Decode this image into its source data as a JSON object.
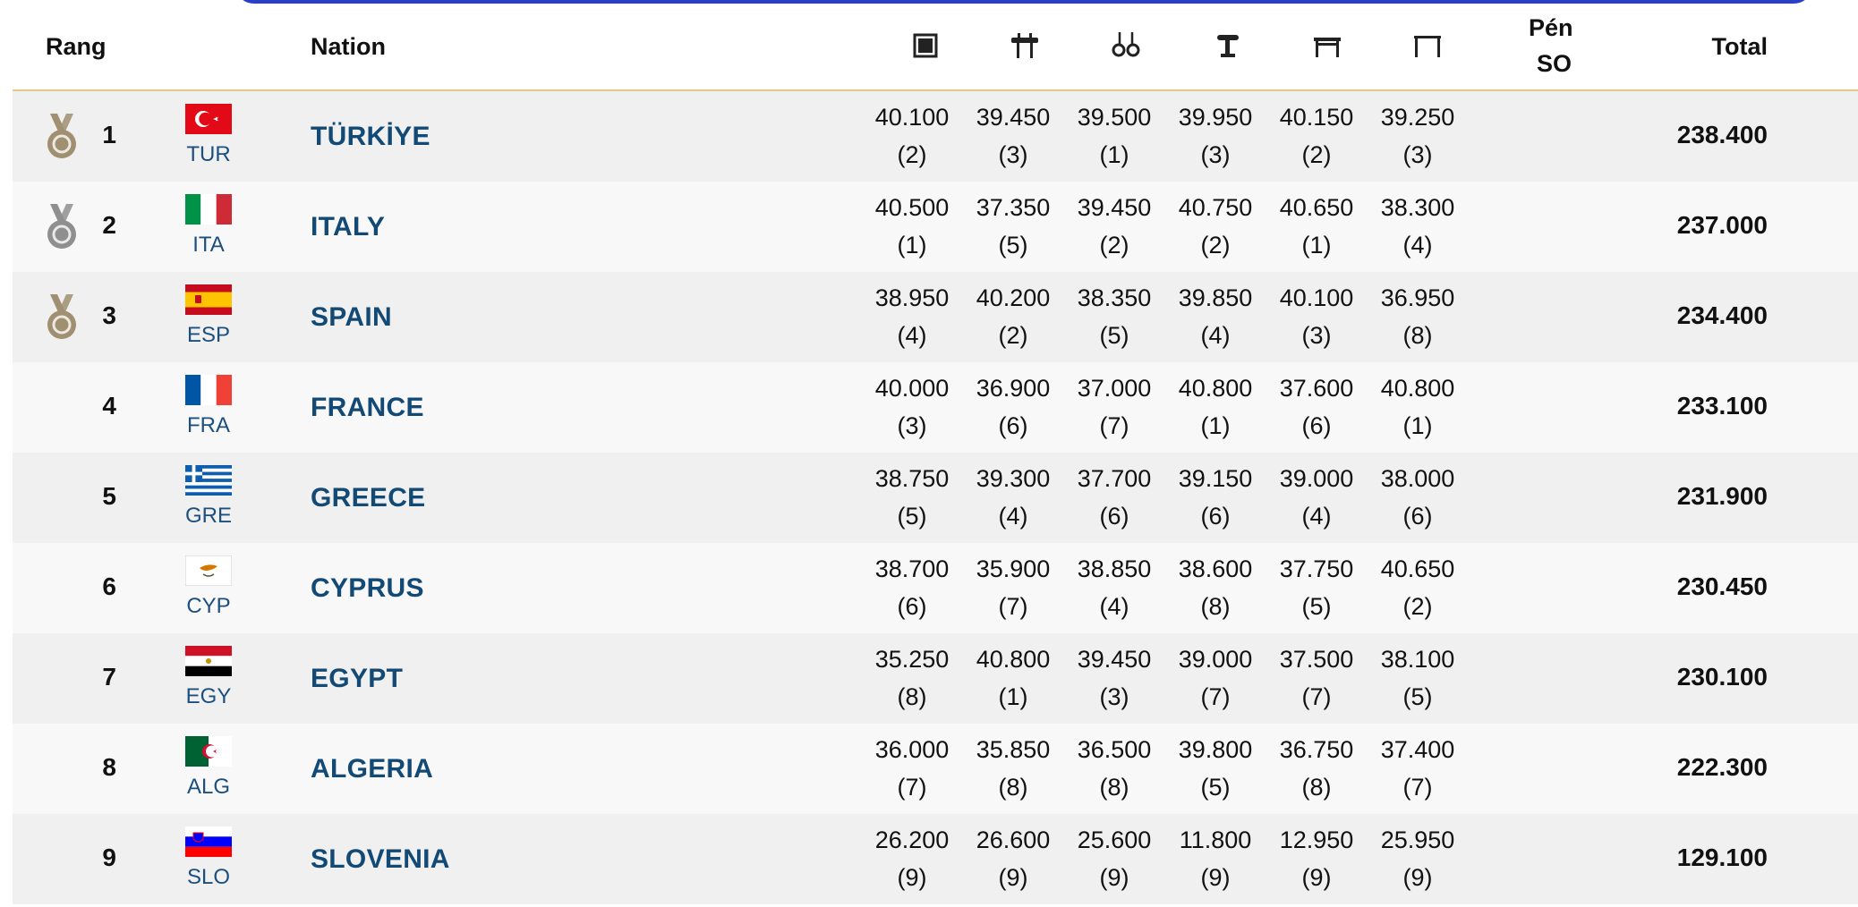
{
  "header": {
    "rank": "Rang",
    "nation": "Nation",
    "apparatus_icons": [
      "floor-exercise-icon",
      "pommel-horse-icon",
      "rings-icon",
      "vault-icon",
      "parallel-bars-icon",
      "horizontal-bar-icon"
    ],
    "penalty_line1": "Pén",
    "penalty_line2": "SO",
    "total": "Total"
  },
  "rows": [
    {
      "rank": "1",
      "medal": "gold",
      "code": "TUR",
      "nation": "TÜRKİYE",
      "scores": [
        [
          "40.100",
          "(2)"
        ],
        [
          "39.450",
          "(3)"
        ],
        [
          "39.500",
          "(1)"
        ],
        [
          "39.950",
          "(3)"
        ],
        [
          "40.150",
          "(2)"
        ],
        [
          "39.250",
          "(3)"
        ]
      ],
      "total": "238.400"
    },
    {
      "rank": "2",
      "medal": "silver",
      "code": "ITA",
      "nation": "ITALY",
      "scores": [
        [
          "40.500",
          "(1)"
        ],
        [
          "37.350",
          "(5)"
        ],
        [
          "39.450",
          "(2)"
        ],
        [
          "40.750",
          "(2)"
        ],
        [
          "40.650",
          "(1)"
        ],
        [
          "38.300",
          "(4)"
        ]
      ],
      "total": "237.000"
    },
    {
      "rank": "3",
      "medal": "bronze",
      "code": "ESP",
      "nation": "SPAIN",
      "scores": [
        [
          "38.950",
          "(4)"
        ],
        [
          "40.200",
          "(2)"
        ],
        [
          "38.350",
          "(5)"
        ],
        [
          "39.850",
          "(4)"
        ],
        [
          "40.100",
          "(3)"
        ],
        [
          "36.950",
          "(8)"
        ]
      ],
      "total": "234.400"
    },
    {
      "rank": "4",
      "medal": "",
      "code": "FRA",
      "nation": "FRANCE",
      "scores": [
        [
          "40.000",
          "(3)"
        ],
        [
          "36.900",
          "(6)"
        ],
        [
          "37.000",
          "(7)"
        ],
        [
          "40.800",
          "(1)"
        ],
        [
          "37.600",
          "(6)"
        ],
        [
          "40.800",
          "(1)"
        ]
      ],
      "total": "233.100"
    },
    {
      "rank": "5",
      "medal": "",
      "code": "GRE",
      "nation": "GREECE",
      "scores": [
        [
          "38.750",
          "(5)"
        ],
        [
          "39.300",
          "(4)"
        ],
        [
          "37.700",
          "(6)"
        ],
        [
          "39.150",
          "(6)"
        ],
        [
          "39.000",
          "(4)"
        ],
        [
          "38.000",
          "(6)"
        ]
      ],
      "total": "231.900"
    },
    {
      "rank": "6",
      "medal": "",
      "code": "CYP",
      "nation": "CYPRUS",
      "scores": [
        [
          "38.700",
          "(6)"
        ],
        [
          "35.900",
          "(7)"
        ],
        [
          "38.850",
          "(4)"
        ],
        [
          "38.600",
          "(8)"
        ],
        [
          "37.750",
          "(5)"
        ],
        [
          "40.650",
          "(2)"
        ]
      ],
      "total": "230.450"
    },
    {
      "rank": "7",
      "medal": "",
      "code": "EGY",
      "nation": "EGYPT",
      "scores": [
        [
          "35.250",
          "(8)"
        ],
        [
          "40.800",
          "(1)"
        ],
        [
          "39.450",
          "(3)"
        ],
        [
          "39.000",
          "(7)"
        ],
        [
          "37.500",
          "(7)"
        ],
        [
          "38.100",
          "(5)"
        ]
      ],
      "total": "230.100"
    },
    {
      "rank": "8",
      "medal": "",
      "code": "ALG",
      "nation": "ALGERIA",
      "scores": [
        [
          "36.000",
          "(7)"
        ],
        [
          "35.850",
          "(8)"
        ],
        [
          "36.500",
          "(8)"
        ],
        [
          "39.800",
          "(5)"
        ],
        [
          "36.750",
          "(8)"
        ],
        [
          "37.400",
          "(7)"
        ]
      ],
      "total": "222.300"
    },
    {
      "rank": "9",
      "medal": "",
      "code": "SLO",
      "nation": "SLOVENIA",
      "scores": [
        [
          "26.200",
          "(9)"
        ],
        [
          "26.600",
          "(9)"
        ],
        [
          "25.600",
          "(9)"
        ],
        [
          "11.800",
          "(9)"
        ],
        [
          "12.950",
          "(9)"
        ],
        [
          "25.950",
          "(9)"
        ]
      ],
      "total": "129.100"
    }
  ],
  "colors": {
    "nation_text": "#134a75",
    "header_rule": "#e6c98a",
    "top_frame": "#2b3fc2",
    "gold_medal": "#a08f70",
    "silver_medal": "#8f8f8f",
    "bronze_medal": "#a08f70"
  }
}
